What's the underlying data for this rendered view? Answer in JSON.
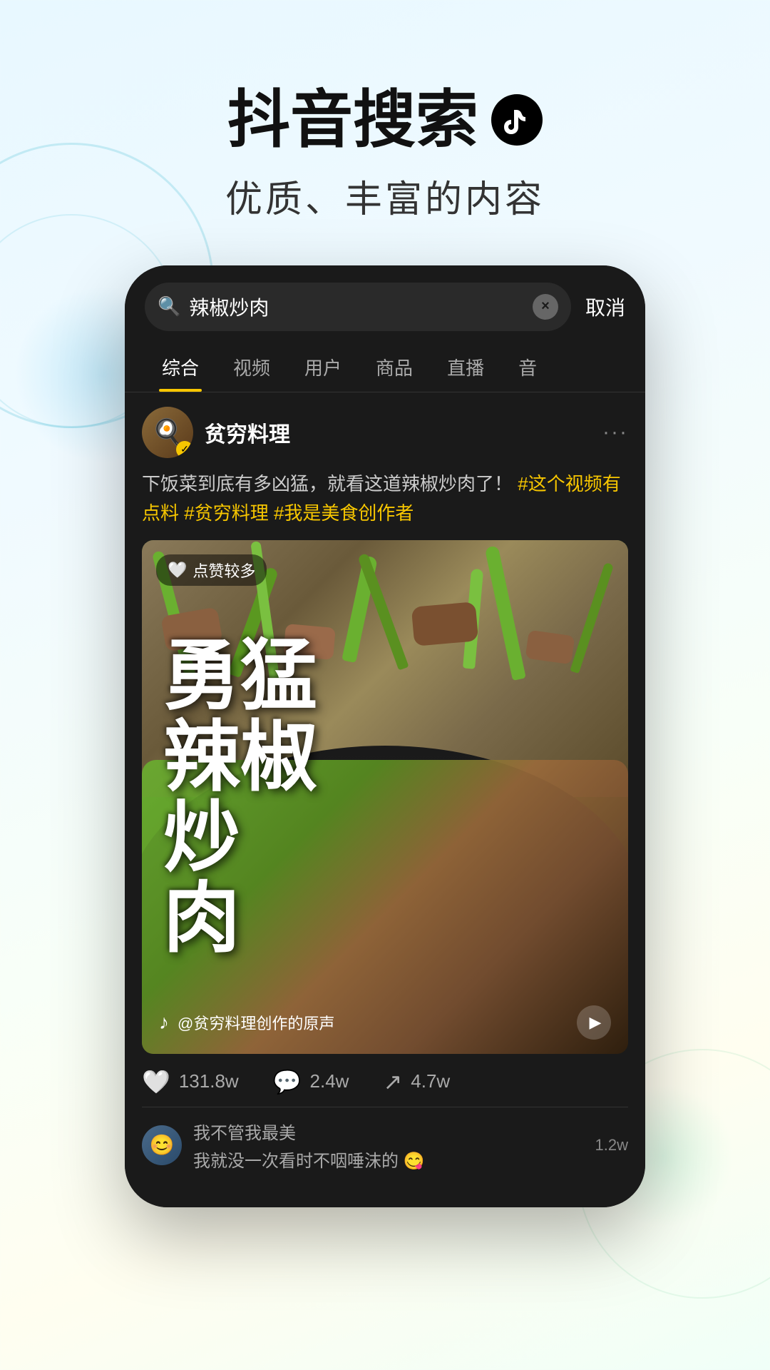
{
  "page": {
    "background": {
      "gradient_start": "#e8f8ff",
      "gradient_end": "#f0fff8"
    }
  },
  "header": {
    "main_title": "抖音搜索",
    "tiktok_icon_label": "tiktok-logo",
    "subtitle": "优质、丰富的内容"
  },
  "phone": {
    "search_bar": {
      "search_icon": "🔍",
      "query_text": "辣椒炒肉",
      "clear_icon": "×",
      "cancel_label": "取消"
    },
    "tabs": [
      {
        "id": "comprehensive",
        "label": "综合",
        "active": true
      },
      {
        "id": "video",
        "label": "视频",
        "active": false
      },
      {
        "id": "user",
        "label": "用户",
        "active": false
      },
      {
        "id": "product",
        "label": "商品",
        "active": false
      },
      {
        "id": "live",
        "label": "直播",
        "active": false
      },
      {
        "id": "audio",
        "label": "音",
        "active": false
      }
    ],
    "result_card": {
      "user": {
        "name": "贫穷料理",
        "avatar_emoji": "🍳",
        "verified": true,
        "more_icon": "···"
      },
      "description": "下饭菜到底有多凶猛，就看这道辣椒炒肉了！",
      "hashtags": [
        "#这个视频有点料",
        "#贫穷料理",
        "#我是美食创作者"
      ],
      "video": {
        "likes_badge": "点赞较多",
        "overlay_text_lines": [
          "勇",
          "猛",
          "辣",
          "椒",
          "炒",
          "肉"
        ],
        "overlay_text_display": "勇猛辣椒炒肉",
        "audio_info": "@贫穷料理创作的原声",
        "tiktok_note_icon": "♪"
      },
      "stats": {
        "likes": "131.8w",
        "comments": "2.4w",
        "shares": "4.7w",
        "likes_icon": "♡",
        "comments_icon": "💬",
        "shares_icon": "↗"
      },
      "comment_preview": {
        "commenter": "我不管我最美",
        "text": "我就没一次看时不咽唾沫的 😋",
        "count": "1.2w"
      }
    }
  }
}
